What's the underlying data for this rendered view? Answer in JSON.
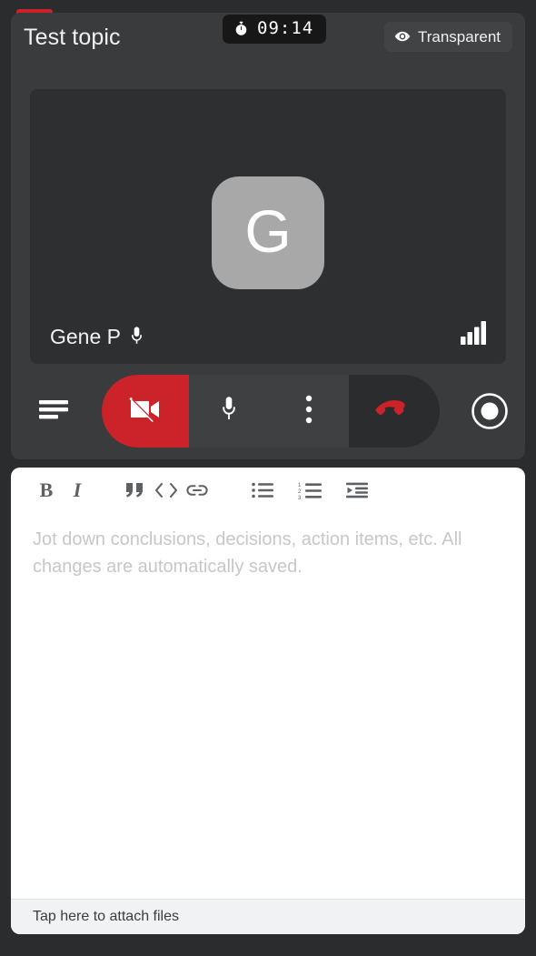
{
  "window": {
    "accent_color": "#cc2229",
    "background_color": "#2b2c2e"
  },
  "call": {
    "topic_title": "Test topic",
    "timer": {
      "icon": "stopwatch-icon",
      "value": "09:14"
    },
    "transparent_toggle": {
      "icon": "eye-icon",
      "label": "Transparent"
    },
    "video_tile": {
      "avatar_initial": "G",
      "participant_name": "Gene P",
      "mic_icon": "microphone-icon",
      "signal_icon": "signal-bars-icon",
      "signal_bars_filled": 4,
      "signal_bars_total": 4
    },
    "controls": [
      {
        "name": "notes-button",
        "icon": "notes-lines-icon",
        "state": "default"
      },
      {
        "name": "camera-button",
        "icon": "camera-off-icon",
        "state": "off",
        "color": "#cc2229"
      },
      {
        "name": "microphone-button",
        "icon": "microphone-icon",
        "state": "on"
      },
      {
        "name": "more-options-button",
        "icon": "three-dots-vertical-icon",
        "state": "default"
      },
      {
        "name": "end-call-button",
        "icon": "hangup-phone-icon",
        "state": "default",
        "color": "#cc2229"
      },
      {
        "name": "record-button",
        "icon": "record-circle-icon",
        "state": "default"
      }
    ]
  },
  "notes": {
    "toolbar": [
      {
        "name": "bold-button",
        "icon": "bold-icon",
        "label": "B"
      },
      {
        "name": "italic-button",
        "icon": "italic-icon",
        "label": "I"
      },
      {
        "name": "quote-button",
        "icon": "quote-icon"
      },
      {
        "name": "code-button",
        "icon": "code-brackets-icon"
      },
      {
        "name": "link-button",
        "icon": "link-icon"
      },
      {
        "name": "bullet-list-button",
        "icon": "bullet-list-icon"
      },
      {
        "name": "numbered-list-button",
        "icon": "numbered-list-icon"
      },
      {
        "name": "outdent-button",
        "icon": "outdent-icon"
      }
    ],
    "editor": {
      "value": "",
      "placeholder": "Jot down conclusions, decisions, action items, etc. All changes are automatically saved."
    },
    "attach": {
      "label": "Tap here to attach files"
    }
  }
}
